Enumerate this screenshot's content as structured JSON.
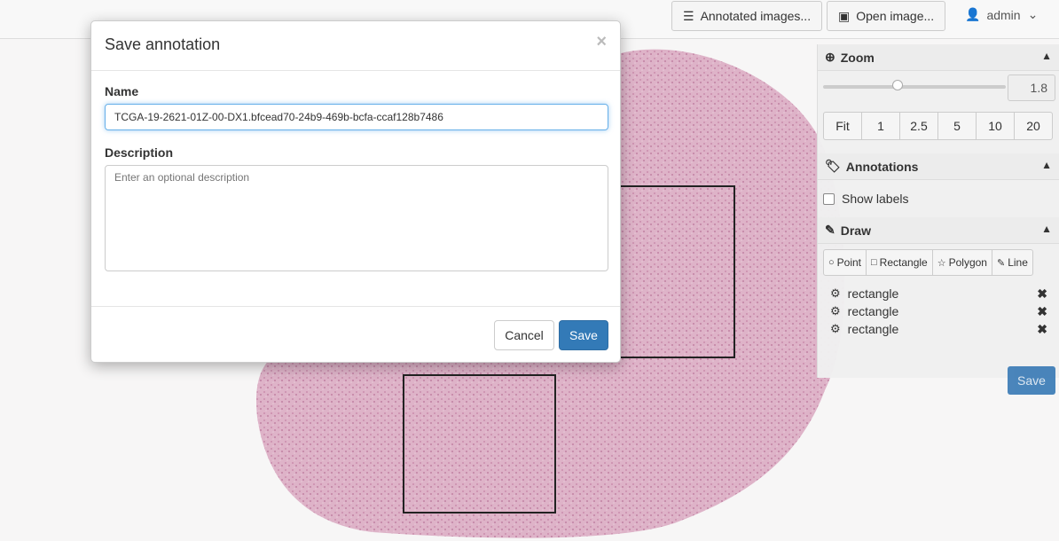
{
  "navbar": {
    "annotated_images_label": "Annotated images...",
    "open_image_label": "Open image...",
    "user_label": "admin"
  },
  "panel": {
    "zoom": {
      "title": "Zoom",
      "value": "1.8",
      "slider_fraction": 0.41,
      "presets": [
        "Fit",
        "1",
        "2.5",
        "5",
        "10",
        "20"
      ]
    },
    "annotations": {
      "title": "Annotations",
      "show_labels": "Show labels"
    },
    "draw": {
      "title": "Draw",
      "tools": [
        "Point",
        "Rectangle",
        "Polygon",
        "Line"
      ],
      "items": [
        "rectangle",
        "rectangle",
        "rectangle"
      ],
      "save_label": "Save"
    }
  },
  "modal": {
    "title": "Save annotation",
    "close_glyph": "×",
    "name_label": "Name",
    "name_value": "TCGA-19-2621-01Z-00-DX1.bfcead70-24b9-469b-bcfa-ccaf128b7486",
    "description_label": "Description",
    "description_placeholder": "Enter an optional description",
    "cancel_label": "Cancel",
    "save_label": "Save"
  }
}
